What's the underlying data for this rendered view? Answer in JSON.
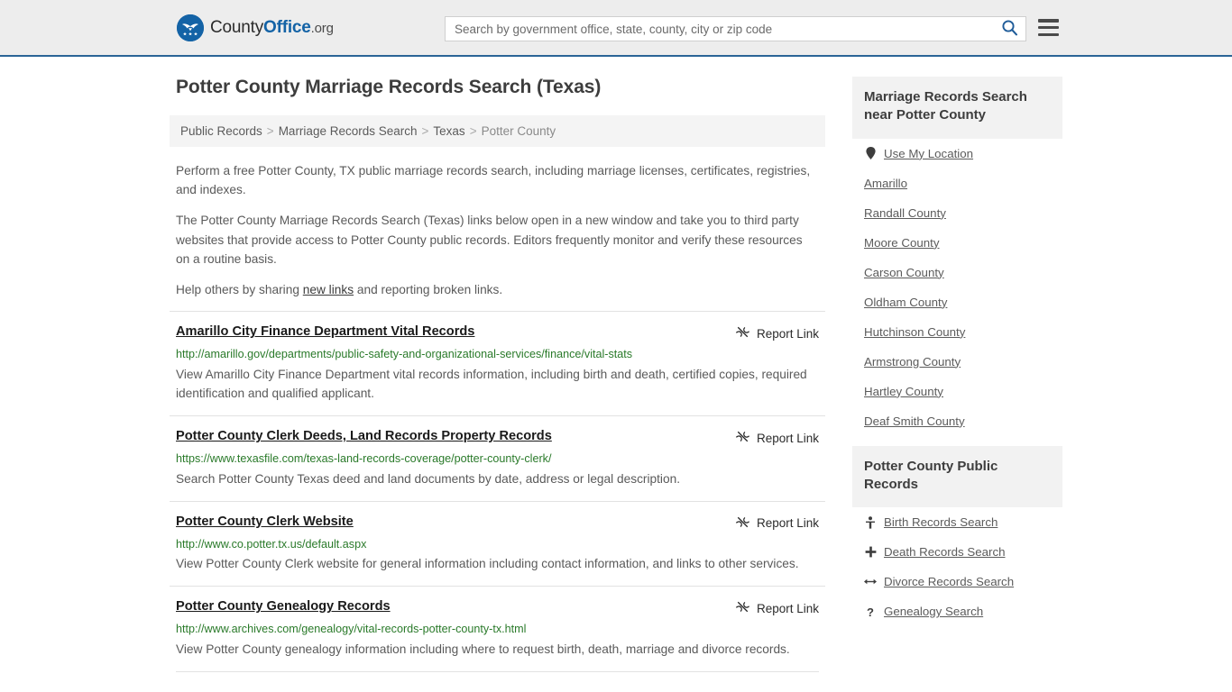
{
  "header": {
    "logo_text_part1": "County",
    "logo_text_part2": "Office",
    "logo_text_part3": ".org",
    "logo_icon": "eagle-stars-seal-icon",
    "search_placeholder": "Search by government office, state, county, city or zip code",
    "search_value": "",
    "search_icon": "search-icon",
    "menu_icon": "hamburger-menu-icon"
  },
  "page": {
    "title": "Potter County Marriage Records Search (Texas)"
  },
  "breadcrumb": {
    "items": [
      {
        "label": "Public Records",
        "link": true
      },
      {
        "label": "Marriage Records Search",
        "link": true
      },
      {
        "label": "Texas",
        "link": true
      },
      {
        "label": "Potter County",
        "link": false
      }
    ],
    "separator": ">"
  },
  "intro": {
    "p1": "Perform a free Potter County, TX public marriage records search, including marriage licenses, certificates, registries, and indexes.",
    "p2": "The Potter County Marriage Records Search (Texas) links below open in a new window and take you to third party websites that provide access to Potter County public records. Editors frequently monitor and verify these resources on a routine basis.",
    "p3_before": "Help others by sharing ",
    "p3_link": "new links",
    "p3_after": " and reporting broken links."
  },
  "results": {
    "report_label": "Report Link",
    "report_icon": "broken-link-icon",
    "items": [
      {
        "title": "Amarillo City Finance Department Vital Records",
        "url": "http://amarillo.gov/departments/public-safety-and-organizational-services/finance/vital-stats",
        "description": "View Amarillo City Finance Department vital records information, including birth and death, certified copies, required identification and qualified applicant."
      },
      {
        "title": "Potter County Clerk Deeds, Land Records Property Records",
        "url": "https://www.texasfile.com/texas-land-records-coverage/potter-county-clerk/",
        "description": "Search Potter County Texas deed and land documents by date, address or legal description."
      },
      {
        "title": "Potter County Clerk Website",
        "url": "http://www.co.potter.tx.us/default.aspx",
        "description": "View Potter County Clerk website for general information including contact information, and links to other services."
      },
      {
        "title": "Potter County Genealogy Records",
        "url": "http://www.archives.com/genealogy/vital-records-potter-county-tx.html",
        "description": "View Potter County genealogy information including where to request birth, death, marriage and divorce records."
      }
    ]
  },
  "sidebar": {
    "nearby": {
      "heading": "Marriage Records Search near Potter County",
      "items": [
        {
          "label": "Use My Location",
          "icon": "map-pin-icon"
        },
        {
          "label": "Amarillo",
          "icon": ""
        },
        {
          "label": "Randall County",
          "icon": ""
        },
        {
          "label": "Moore County",
          "icon": ""
        },
        {
          "label": "Carson County",
          "icon": ""
        },
        {
          "label": "Oldham County",
          "icon": ""
        },
        {
          "label": "Hutchinson County",
          "icon": ""
        },
        {
          "label": "Armstrong County",
          "icon": ""
        },
        {
          "label": "Hartley County",
          "icon": ""
        },
        {
          "label": "Deaf Smith County",
          "icon": ""
        }
      ]
    },
    "public_records": {
      "heading": "Potter County Public Records",
      "items": [
        {
          "label": "Birth Records Search",
          "icon": "baby-icon"
        },
        {
          "label": "Death Records Search",
          "icon": "cross-icon"
        },
        {
          "label": "Divorce Records Search",
          "icon": "left-right-arrow-icon"
        },
        {
          "label": "Genealogy Search",
          "icon": "question-mark-icon"
        }
      ]
    }
  },
  "colors": {
    "brand_blue": "#1463a6",
    "header_bg": "#ededed",
    "url_green": "#2a7a2a",
    "panel_gray": "#f2f2f2"
  }
}
